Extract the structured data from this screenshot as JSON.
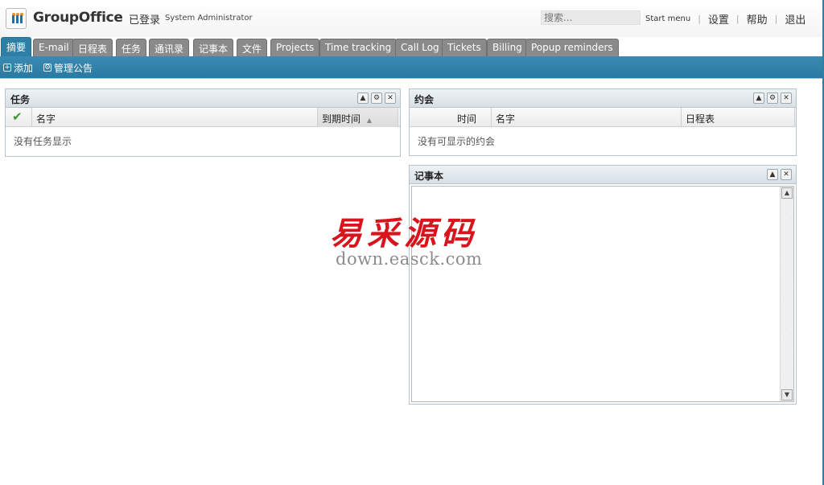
{
  "header": {
    "brand": "GroupOffice",
    "logged_in_label": "已登录",
    "user_name": "System Administrator",
    "search_placeholder": "搜索...",
    "links": [
      "Start menu",
      "设置",
      "帮助",
      "退出"
    ]
  },
  "tabs": [
    "摘要",
    "E-mail",
    "日程表",
    "任务",
    "通讯录",
    "记事本",
    "文件",
    "Projects",
    "Time tracking",
    "Call Log",
    "Tickets",
    "Billing",
    "Popup reminders"
  ],
  "toolbar": {
    "add_label": "添加",
    "manage_label": "管理公告"
  },
  "tasks": {
    "title": "任务",
    "columns": [
      "名字",
      "到期时间"
    ],
    "empty": "没有任务显示"
  },
  "appointments": {
    "title": "约会",
    "columns": [
      "时间",
      "名字",
      "日程表"
    ],
    "empty": "没有可显示的约会"
  },
  "notes": {
    "title": "记事本"
  },
  "watermark": {
    "cn": "易采源码",
    "en": "down.easck.com"
  },
  "colors": {
    "accent": "#2e7ea6",
    "tab_inactive": "#8a8a8a",
    "watermark_red": "#d8151c"
  }
}
